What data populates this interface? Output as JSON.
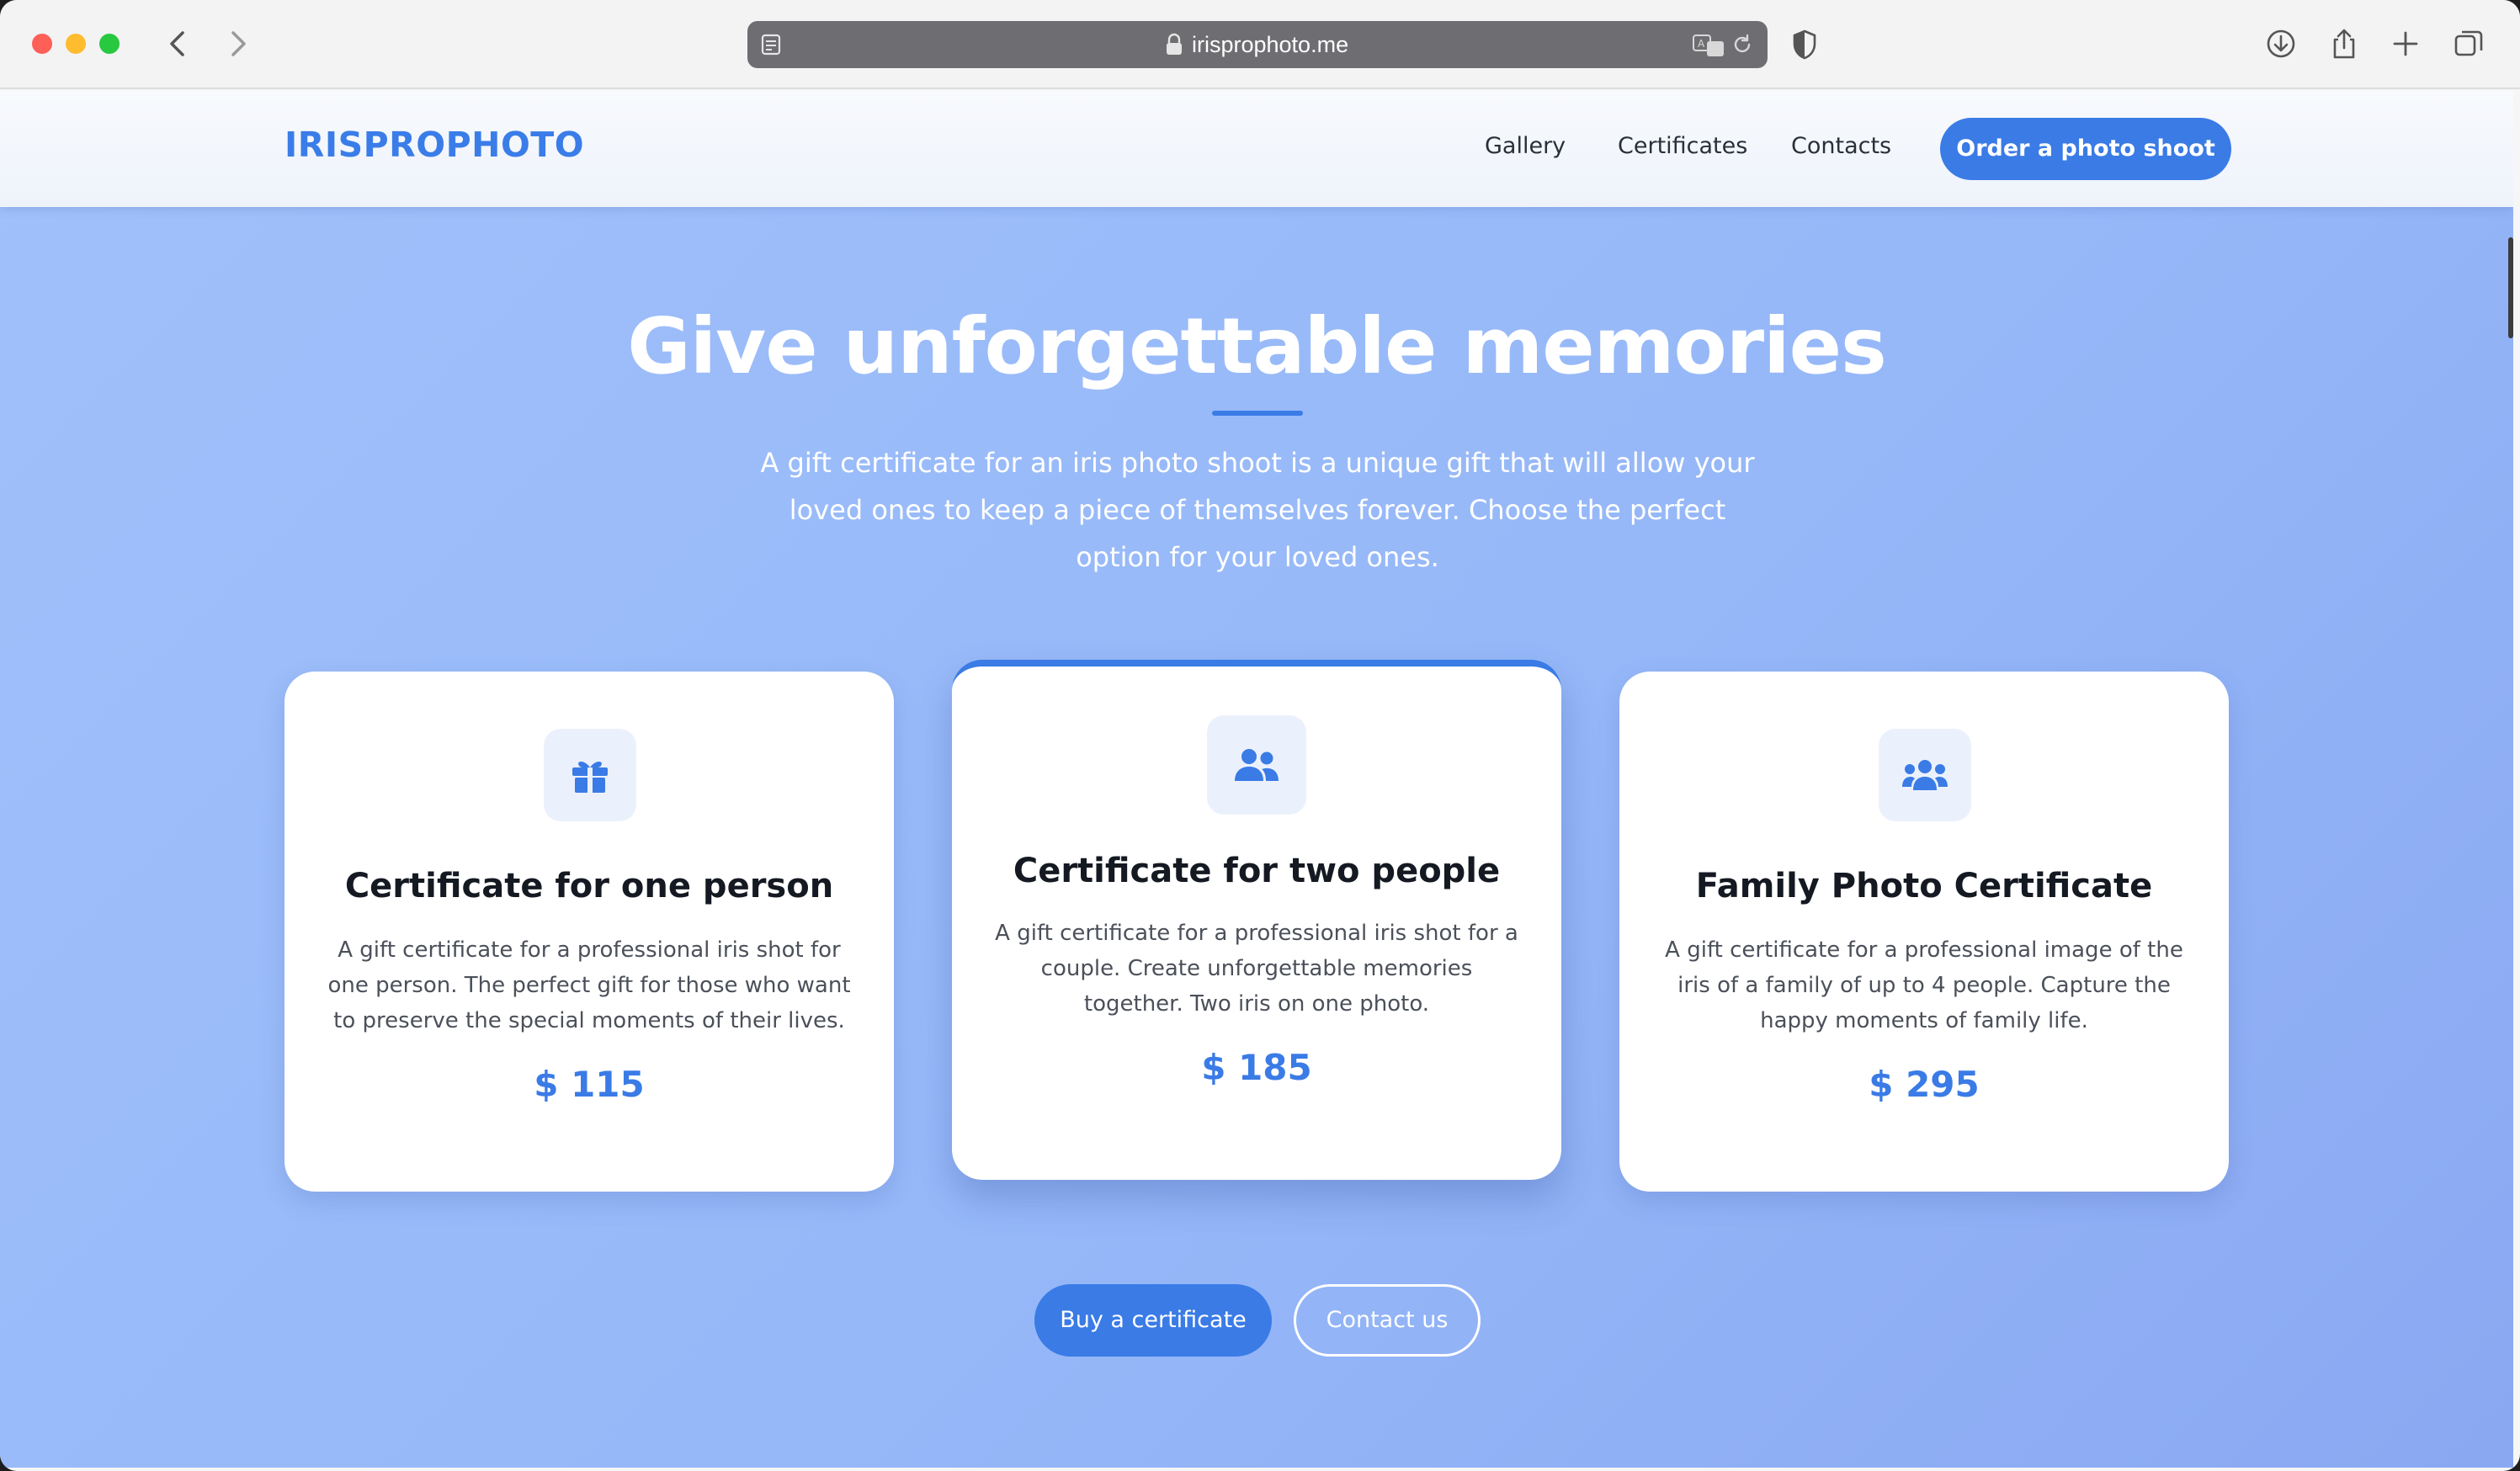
{
  "browser": {
    "url": "irisprophoto.me",
    "icons": [
      "sidebar-icon",
      "lock-icon",
      "translate-icon",
      "reload-icon",
      "shield-icon",
      "download-icon",
      "share-icon",
      "new-tab-icon",
      "tab-overview-icon",
      "back-icon",
      "forward-icon"
    ]
  },
  "header": {
    "logo": "IRISPROPHOTO",
    "menu": {
      "gallery": "Gallery",
      "certificates": "Certificates",
      "contacts": "Contacts"
    },
    "cta": "Order a photo shoot"
  },
  "hero": {
    "title": "Give unforgettable memories",
    "subtitle": "A gift certificate for an iris photo shoot is a unique gift that will allow your loved ones to keep a piece of themselves forever. Choose the perfect option for your loved ones."
  },
  "cards": [
    {
      "icon": "gift-icon",
      "title": "Certificate for one person",
      "text": "A gift certificate for a professional iris shot for one person. The perfect gift for those who want to preserve the special moments of their lives.",
      "price": "$ 115"
    },
    {
      "icon": "two-people-icon",
      "title": "Certificate for two people",
      "text": "A gift certificate for a professional iris shot for a couple. Create unforgettable memories together. Two iris on one photo.",
      "price": "$ 185"
    },
    {
      "icon": "family-icon",
      "title": "Family Photo Certificate",
      "text": "A gift certificate for a professional image of the iris of a family of up to 4 people. Capture the happy moments of family life.",
      "price": "$ 295"
    }
  ],
  "actions": {
    "buy": "Buy a certificate",
    "contact": "Contact us"
  },
  "colors": {
    "accent": "#3a7be6",
    "background": "#96b8f8"
  }
}
